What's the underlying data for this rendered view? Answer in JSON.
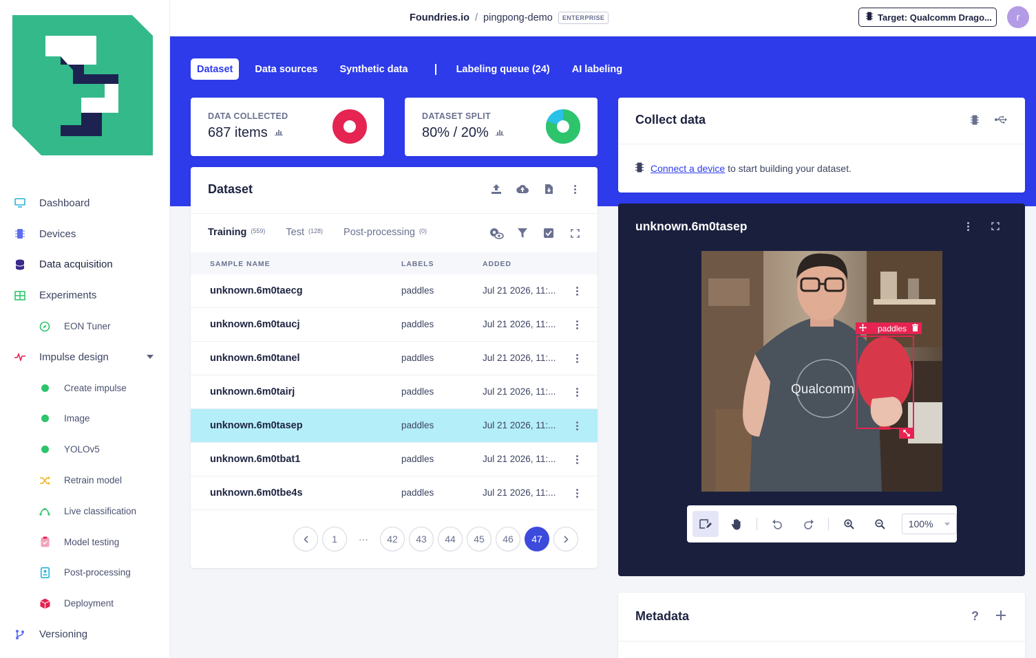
{
  "sidebar": {
    "items": [
      {
        "label": "Dashboard",
        "icon": "monitor-icon"
      },
      {
        "label": "Devices",
        "icon": "chip-icon"
      },
      {
        "label": "Data acquisition",
        "icon": "database-icon"
      },
      {
        "label": "Experiments",
        "icon": "grid-icon"
      },
      {
        "label": "EON Tuner",
        "icon": "compass-icon"
      },
      {
        "label": "Impulse design",
        "icon": "pulse-icon"
      },
      {
        "label": "Create impulse",
        "icon": "dot-icon"
      },
      {
        "label": "Image",
        "icon": "dot-icon"
      },
      {
        "label": "YOLOv5",
        "icon": "dot-icon"
      },
      {
        "label": "Retrain model",
        "icon": "shuffle-icon"
      },
      {
        "label": "Live classification",
        "icon": "graph-icon"
      },
      {
        "label": "Model testing",
        "icon": "clipboard-icon"
      },
      {
        "label": "Post-processing",
        "icon": "document-icon"
      },
      {
        "label": "Deployment",
        "icon": "cube-icon"
      },
      {
        "label": "Versioning",
        "icon": "branch-icon"
      }
    ]
  },
  "topbar": {
    "org": "Foundries.io",
    "separator": "/",
    "project": "pingpong-demo",
    "badge": "ENTERPRISE",
    "target": "Target: Qualcomm Drago...",
    "avatar": "r"
  },
  "tabs": [
    {
      "label": "Dataset"
    },
    {
      "label": "Data sources"
    },
    {
      "label": "Synthetic data"
    },
    {
      "label": "Labeling queue (24)"
    },
    {
      "label": "AI labeling"
    }
  ],
  "stats": {
    "collected": {
      "label": "DATA COLLECTED",
      "value": "687 items"
    },
    "split": {
      "label": "DATASET SPLIT",
      "value": "80% / 20%",
      "train_fraction": 0.8
    }
  },
  "colors": {
    "accent": "#2d3bea",
    "brand_green": "#33b98a",
    "danger": "#e52452",
    "split_train": "#2ec46c",
    "split_test": "#29c1e8"
  },
  "dataset": {
    "title": "Dataset",
    "subtabs": [
      {
        "label": "Training",
        "count": "(559)"
      },
      {
        "label": "Test",
        "count": "(128)"
      },
      {
        "label": "Post-processing",
        "count": "(0)"
      }
    ],
    "columns": [
      "SAMPLE NAME",
      "LABELS",
      "ADDED"
    ],
    "rows": [
      {
        "name": "unknown.6m0taecg",
        "label": "paddles",
        "added": "Jul 21 2026, 11:..."
      },
      {
        "name": "unknown.6m0taucj",
        "label": "paddles",
        "added": "Jul 21 2026, 11:..."
      },
      {
        "name": "unknown.6m0tanel",
        "label": "paddles",
        "added": "Jul 21 2026, 11:..."
      },
      {
        "name": "unknown.6m0tairj",
        "label": "paddles",
        "added": "Jul 21 2026, 11:..."
      },
      {
        "name": "unknown.6m0tasep",
        "label": "paddles",
        "added": "Jul 21 2026, 11:..."
      },
      {
        "name": "unknown.6m0tbat1",
        "label": "paddles",
        "added": "Jul 21 2026, 11:..."
      },
      {
        "name": "unknown.6m0tbe4s",
        "label": "paddles",
        "added": "Jul 21 2026, 11:..."
      }
    ],
    "pager": {
      "first": "1",
      "ellipsis": "···",
      "pages": [
        "42",
        "43",
        "44",
        "45",
        "46"
      ],
      "current": "47"
    }
  },
  "collect": {
    "title": "Collect data",
    "link": "Connect a device",
    "text": "to start building your dataset."
  },
  "viewer": {
    "title": "unknown.6m0tasep",
    "bbox_label": "paddles",
    "shirt_text": "Qualcomm",
    "zoom": "100%"
  },
  "metadata": {
    "title": "Metadata",
    "help": "?"
  }
}
